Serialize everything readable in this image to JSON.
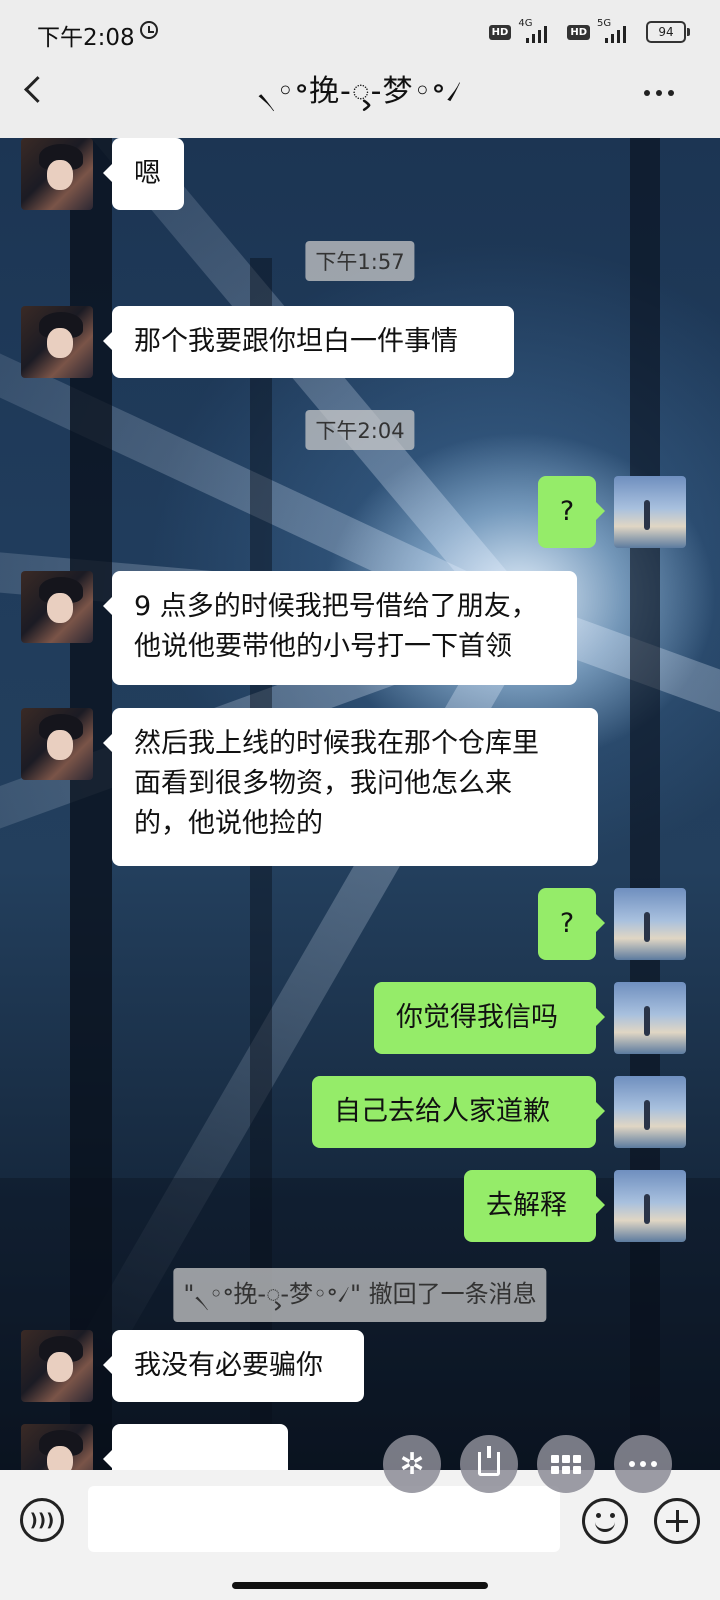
{
  "status_bar": {
    "time": "下午2:08",
    "network_1": "4G",
    "network_2": "5G",
    "battery": "94"
  },
  "header": {
    "title": "৲◦॰挽-ᯮ-梦◦॰৴"
  },
  "messages": [
    {
      "type": "in",
      "text": "嗯"
    },
    {
      "type": "time",
      "text": "下午1:57"
    },
    {
      "type": "in",
      "text": "那个我要跟你坦白一件事情"
    },
    {
      "type": "time",
      "text": "下午2:04"
    },
    {
      "type": "out",
      "text": "?"
    },
    {
      "type": "in",
      "text": "9 点多的时候我把号借给了朋友，\n他说他要带他的小号打一下首领"
    },
    {
      "type": "in",
      "text": "然后我上线的时候我在那个仓库里\n面看到很多物资，我问他怎么来\n的，他说他捡的"
    },
    {
      "type": "out",
      "text": "?"
    },
    {
      "type": "out",
      "text": "你觉得我信吗"
    },
    {
      "type": "out",
      "text": "自己去给人家道歉"
    },
    {
      "type": "out",
      "text": "去解释"
    },
    {
      "type": "recall",
      "text": "\"৲◦॰挽-ᯮ-梦◦॰৴\" 撤回了一条消息"
    },
    {
      "type": "in",
      "text": "我没有必要骗你"
    }
  ],
  "quick_actions": [
    {
      "icon": "sparkle-icon"
    },
    {
      "icon": "download-icon"
    },
    {
      "icon": "grid-icon"
    },
    {
      "icon": "more-dots-icon"
    }
  ],
  "input": {
    "value": "",
    "placeholder": ""
  },
  "colors": {
    "outgoing_bubble": "#95ec69",
    "incoming_bubble": "#ffffff",
    "header_bg": "#ededed"
  }
}
